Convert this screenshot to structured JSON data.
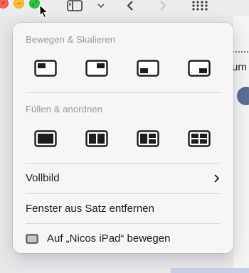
{
  "menu": {
    "section_move": "Bewegen & Skalieren",
    "section_fill": "Füllen & anordnen",
    "fullscreen": "Vollbild",
    "remove_from_set": "Fenster aus Satz entfernen",
    "move_to_ipad": "Auf „Nicos iPad“ bewegen"
  },
  "background": {
    "partial_text": "um"
  },
  "colors": {
    "close": "#ff5f57",
    "minimize": "#febc2e",
    "zoom": "#28c840"
  },
  "icons": {
    "move_tiles": [
      "tile-left-half-icon",
      "tile-right-half-icon",
      "tile-bottom-left-icon",
      "tile-bottom-right-icon"
    ],
    "fill_tiles": [
      "fill-full-icon",
      "arrange-two-columns-icon",
      "arrange-three-panes-icon",
      "arrange-four-grid-icon"
    ]
  }
}
